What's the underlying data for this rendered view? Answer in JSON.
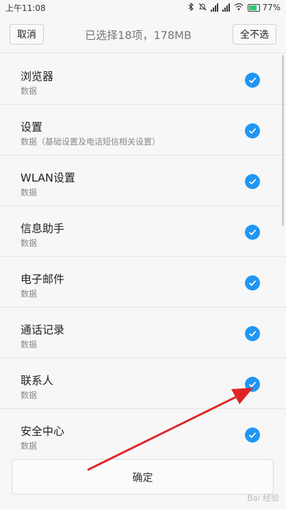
{
  "status_bar": {
    "time": "上午11:08",
    "battery": "77%",
    "battery_level": 0.77
  },
  "header": {
    "cancel_label": "取消",
    "title": "已选择18项，178MB",
    "deselect_all_label": "全不选"
  },
  "items": [
    {
      "title": "浏览器",
      "subtitle": "数据"
    },
    {
      "title": "设置",
      "subtitle": "数据（基础设置及电话短信相关设置）"
    },
    {
      "title": "WLAN设置",
      "subtitle": "数据"
    },
    {
      "title": "信息助手",
      "subtitle": "数据"
    },
    {
      "title": "电子邮件",
      "subtitle": "数据"
    },
    {
      "title": "通话记录",
      "subtitle": "数据"
    },
    {
      "title": "联系人",
      "subtitle": "数据"
    },
    {
      "title": "安全中心",
      "subtitle": "数据"
    }
  ],
  "footer": {
    "confirm_label": "确定"
  },
  "watermark": "Bai 经验",
  "colors": {
    "accent": "#2196f3",
    "arrow": "#e02424",
    "battery": "#2ecc71"
  },
  "icons": [
    "bluetooth-icon",
    "mute-icon",
    "signal-icon",
    "wifi-icon",
    "battery-icon",
    "checkmark-icon",
    "annotation-arrow-icon"
  ]
}
